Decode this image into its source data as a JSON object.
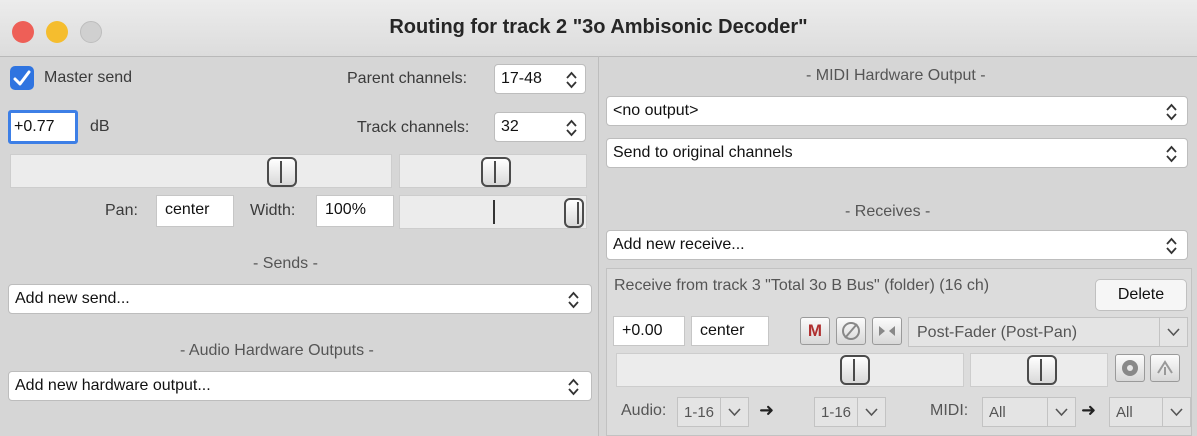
{
  "window": {
    "title": "Routing for track 2 \"3o Ambisonic Decoder\"",
    "colors": {
      "close": "#ee5f57",
      "minimize": "#f5bd2e",
      "zoom": "#d6d6d6",
      "accent": "#2f74e0"
    }
  },
  "left": {
    "master_send": {
      "label": "Master send",
      "checked": true
    },
    "parent_channels": {
      "label": "Parent channels:",
      "value": "17-48"
    },
    "volume": {
      "value": "+0.77",
      "unit": "dB"
    },
    "track_channels": {
      "label": "Track channels:",
      "value": "32"
    },
    "pan": {
      "label": "Pan:",
      "value": "center"
    },
    "width": {
      "label": "Width:",
      "value": "100%"
    },
    "sends": {
      "heading": "- Sends -",
      "add_label": "Add new send..."
    },
    "hardware_outputs": {
      "heading": "- Audio Hardware Outputs -",
      "add_label": "Add new hardware output..."
    }
  },
  "right": {
    "midi_output": {
      "heading": "- MIDI Hardware Output -",
      "device": "<no output>",
      "channel_mode": "Send to original channels"
    },
    "receives": {
      "heading": "- Receives -",
      "add_label": "Add new receive...",
      "items": [
        {
          "title": "Receive from track 3 \"Total 3o B Bus\" (folder) (16 ch)",
          "delete_label": "Delete",
          "volume": "+0.00",
          "pan": "center",
          "mute_label": "M",
          "mode": "Post-Fader (Post-Pan)",
          "audio_label": "Audio:",
          "audio_src": "1-16",
          "audio_dst": "1-16",
          "midi_label": "MIDI:",
          "midi_src": "All",
          "midi_dst": "All",
          "arrow": "➜"
        }
      ]
    }
  }
}
